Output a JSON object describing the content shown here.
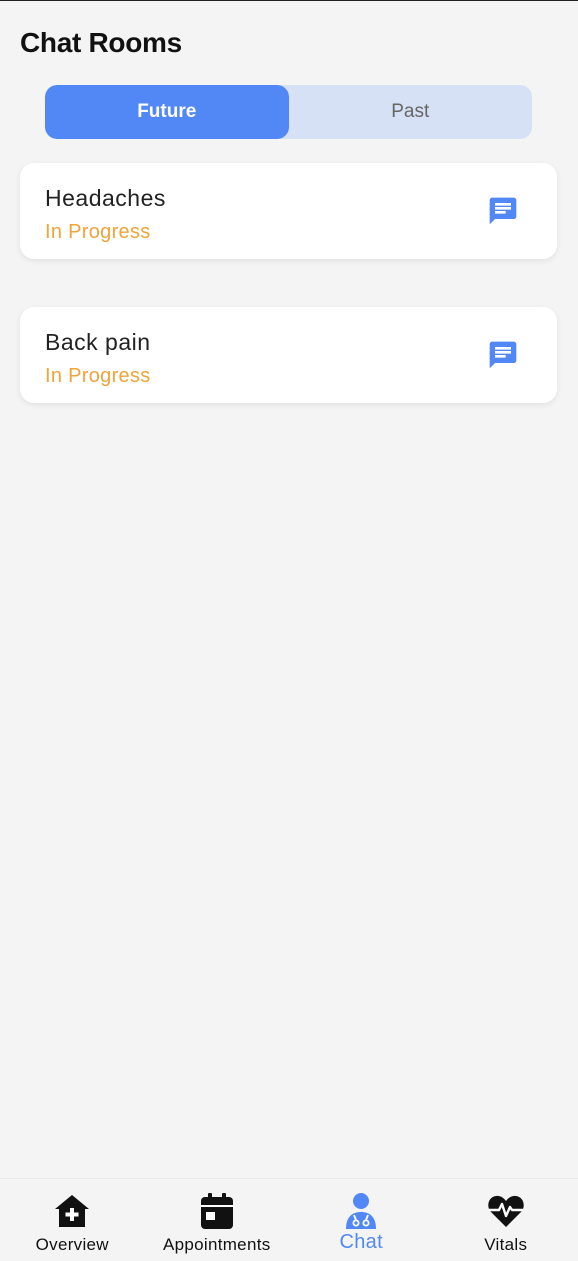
{
  "header": {
    "title": "Chat Rooms"
  },
  "tabs": [
    {
      "label": "Future",
      "active": true
    },
    {
      "label": "Past",
      "active": false
    }
  ],
  "chat_rooms": [
    {
      "title": "Headaches",
      "status": "In Progress",
      "icon": "chat-bubble-icon"
    },
    {
      "title": "Back pain",
      "status": "In Progress",
      "icon": "chat-bubble-icon"
    }
  ],
  "bottom_nav": [
    {
      "label": "Overview",
      "icon": "home-medical-icon",
      "active": false
    },
    {
      "label": "Appointments",
      "icon": "calendar-icon",
      "active": false
    },
    {
      "label": "Chat",
      "icon": "doctor-icon",
      "active": true
    },
    {
      "label": "Vitals",
      "icon": "heart-pulse-icon",
      "active": false
    }
  ],
  "colors": {
    "accent": "#5288f5",
    "tab_track": "#d7e1f5",
    "status_orange": "#f0a43a",
    "background": "#f4f4f4"
  }
}
